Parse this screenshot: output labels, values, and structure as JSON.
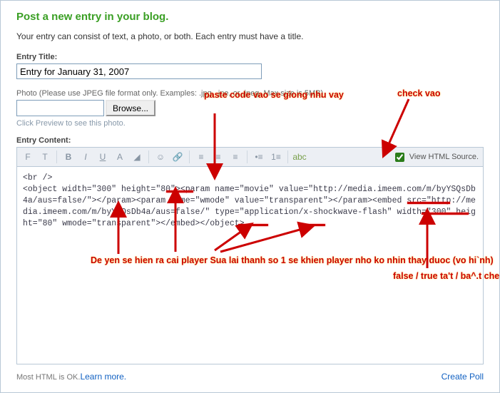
{
  "header": {
    "title": "Post a new entry in your blog.",
    "subtitle": "Your entry can consist of text, a photo, or both. Each entry must have a title."
  },
  "title_field": {
    "label": "Entry Title:",
    "value": "Entry for January 31, 2007"
  },
  "photo": {
    "help": "Photo (Please use JPEG file format only. Examples: .jpg, .jpe, or .jpeg. Max size is 5MB)",
    "browse": "Browse...",
    "preview": "Click Preview to see this photo."
  },
  "content": {
    "label": "Entry Content:",
    "view_src": "View HTML Source.",
    "body": "<br />\n<object width=\"300\" height=\"80\"><param name=\"movie\" value=\"http://media.imeem.com/m/byYSQsDb4a/aus=false/\"></param><param name=\"wmode\" value=\"transparent\"></param><embed src=\"http://media.imeem.com/m/byYSQsDb4a/aus=false/\" type=\"application/x-shockwave-flash\" width=\"300\" height=\"80\" wmode=\"transparent\"></embed></object>"
  },
  "footer": {
    "note": "Most HTML is OK.",
    "learn": "Learn more.",
    "poll": "Create Poll"
  },
  "anno": {
    "paste": "paste code vao\nse giong nhu vay",
    "check": "check vao",
    "left_note": "De yen se hien ra\ncai player\nSua lai thanh so 1\nse khien player nho\nko nhin thay duoc\n(vo hi`nh)",
    "right_note": "false / true\nta't / ba^.t\nche do tu"
  }
}
